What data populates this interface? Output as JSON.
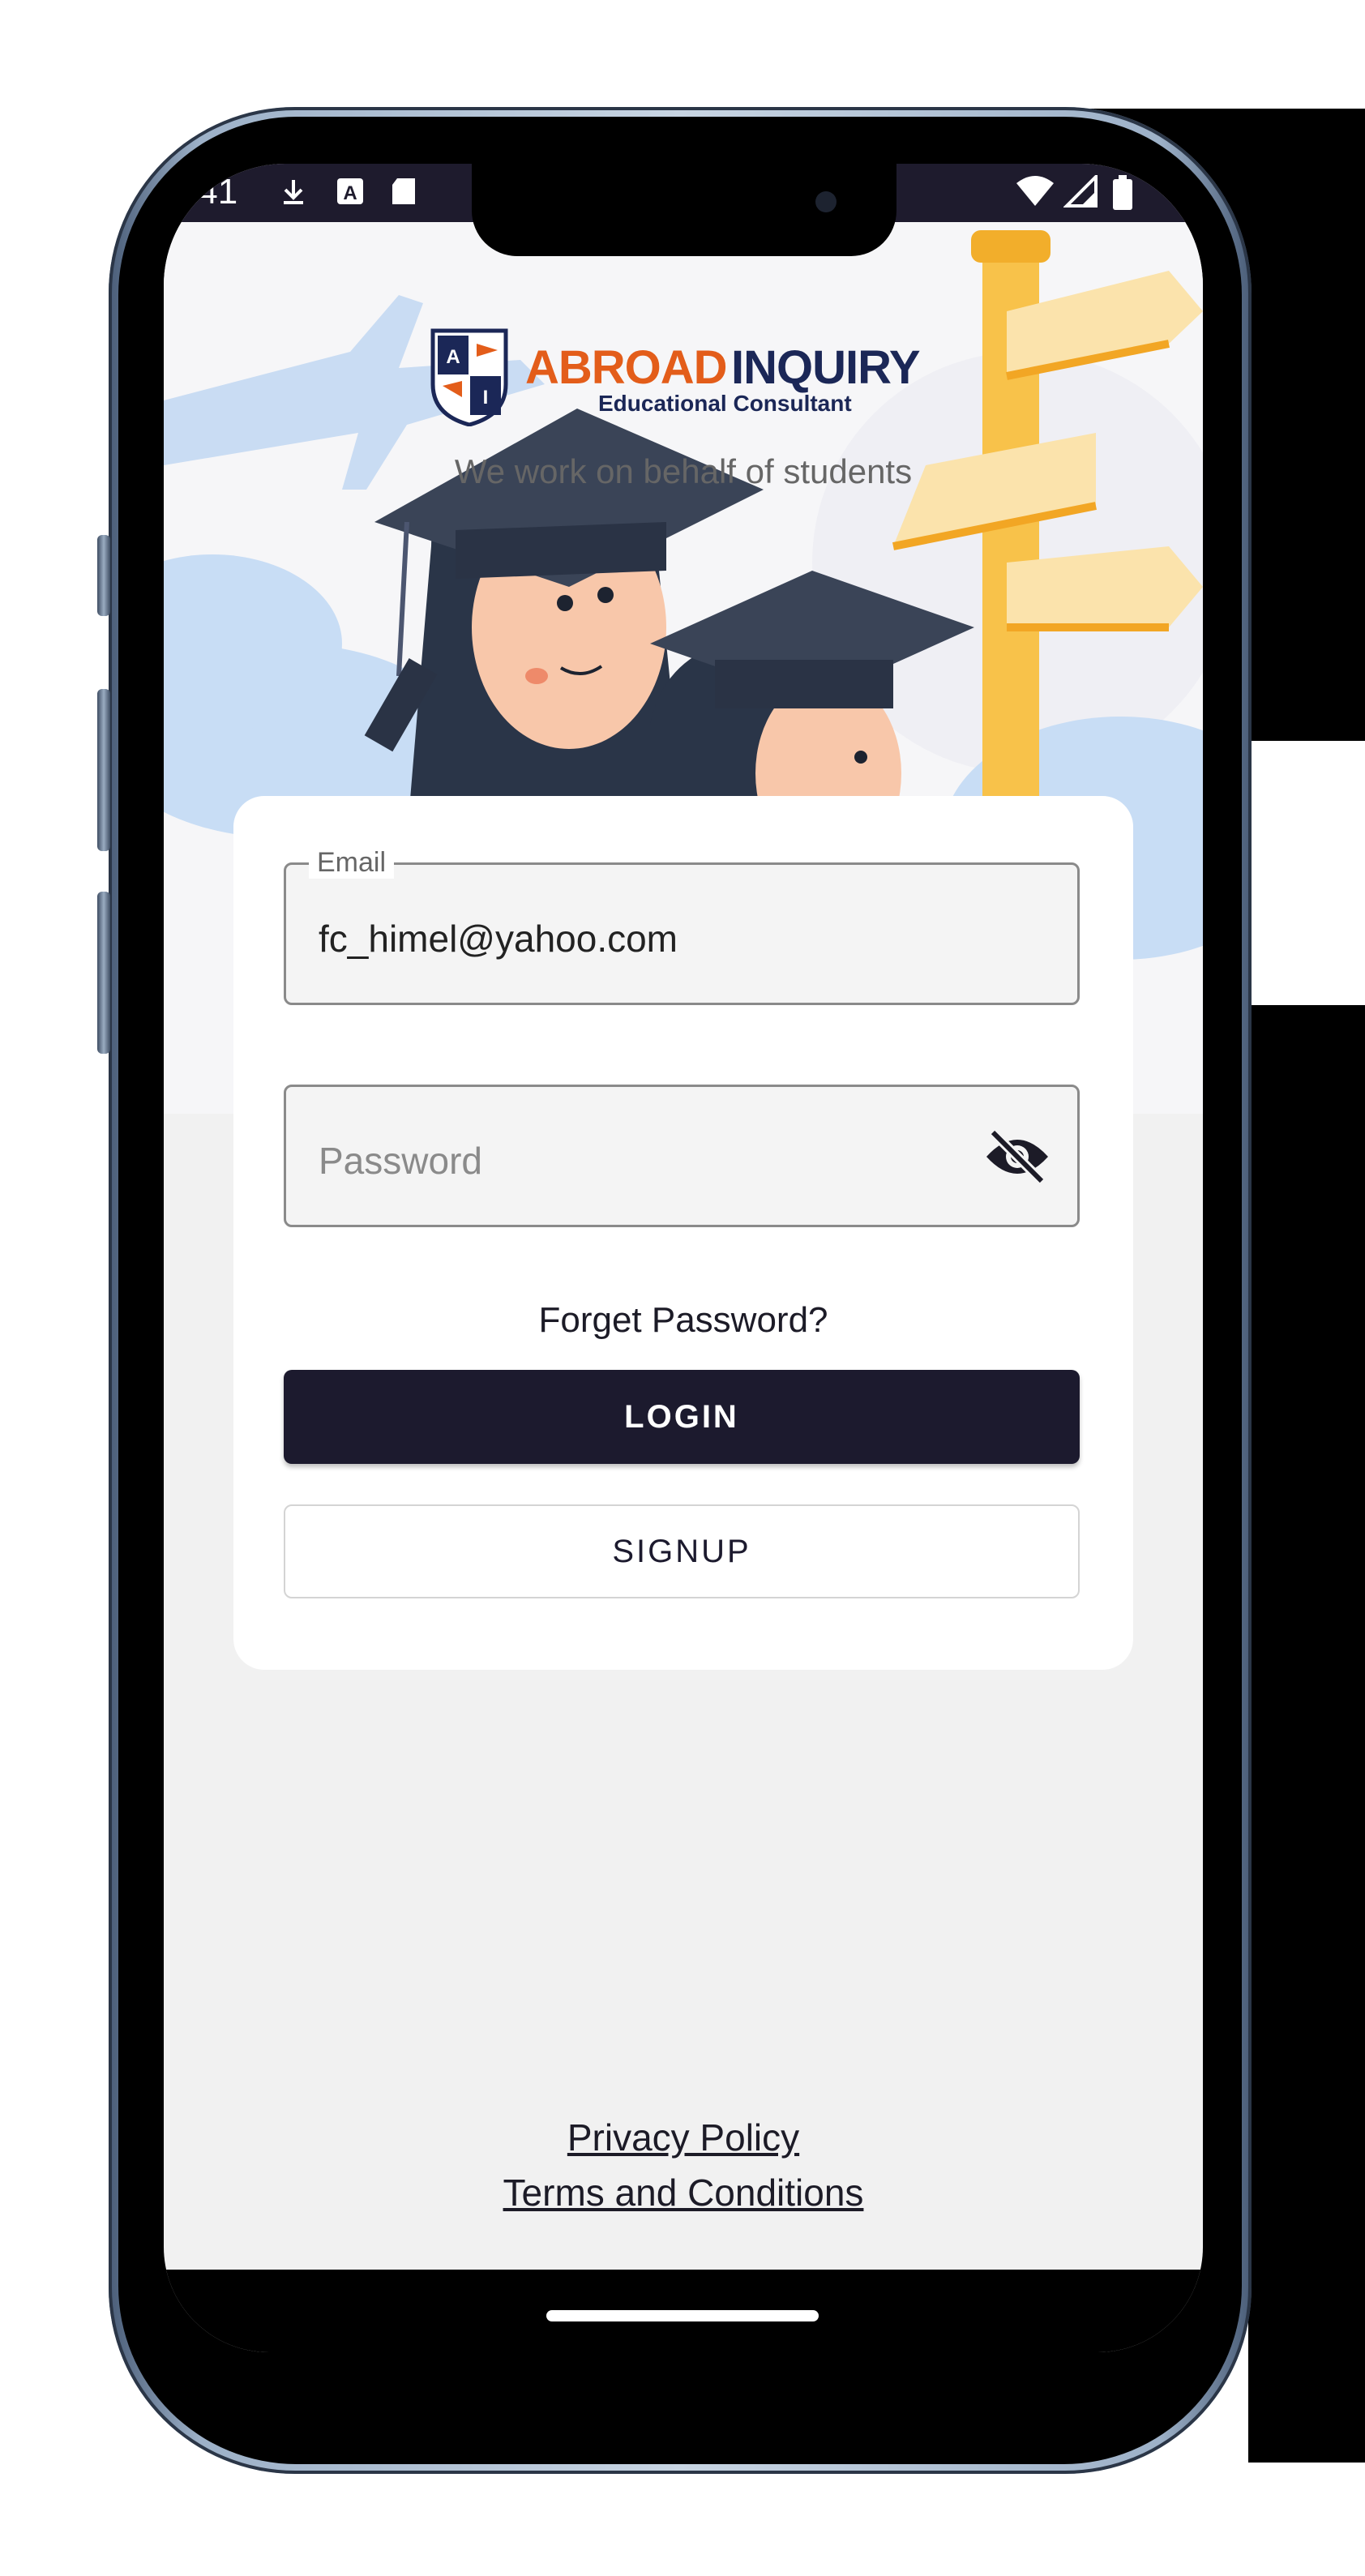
{
  "status_bar": {
    "time": ":41",
    "icons": [
      "download-icon",
      "a-icon",
      "sd-card-icon",
      "wifi-icon",
      "signal-icon",
      "battery-icon"
    ]
  },
  "brand": {
    "name_part1": "ABROAD",
    "name_part2": "INQUIRY",
    "subtitle": "Educational Consultant",
    "tagline": "We work on behalf of students",
    "shield_letters": [
      "A",
      "I"
    ],
    "colors": {
      "orange": "#e35d1a",
      "navy": "#1b2757"
    }
  },
  "login_form": {
    "email_label": "Email",
    "email_value": "fc_himel@yahoo.com",
    "password_placeholder": "Password",
    "forget_password": "Forget Password?",
    "login_button": "LOGIN",
    "signup_button": "SIGNUP"
  },
  "footer": {
    "privacy_policy": "Privacy Policy",
    "terms": "Terms and Conditions"
  },
  "theme": {
    "primary": "#1c1a2e",
    "background": "#f1f1f1"
  }
}
